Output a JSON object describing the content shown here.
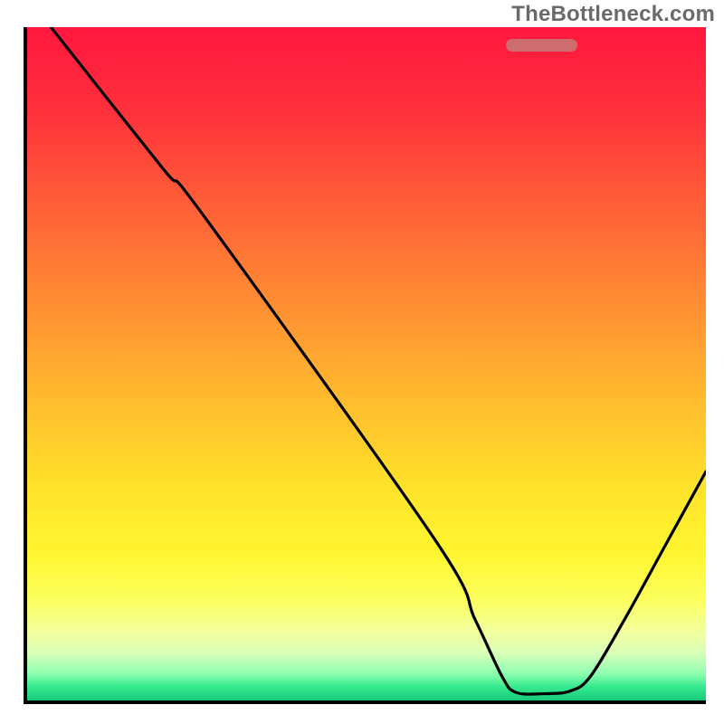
{
  "watermark": "TheBottleneck.com",
  "gradient_stops": [
    {
      "pct": 0,
      "color": "#ff173e"
    },
    {
      "pct": 12,
      "color": "#ff2f3c"
    },
    {
      "pct": 25,
      "color": "#ff5a38"
    },
    {
      "pct": 40,
      "color": "#ff8a33"
    },
    {
      "pct": 55,
      "color": "#ffba2e"
    },
    {
      "pct": 68,
      "color": "#ffe12a"
    },
    {
      "pct": 78,
      "color": "#fff62f"
    },
    {
      "pct": 85,
      "color": "#fcff5d"
    },
    {
      "pct": 90,
      "color": "#f2ffa0"
    },
    {
      "pct": 93,
      "color": "#d8ffb8"
    },
    {
      "pct": 96,
      "color": "#8dffb0"
    },
    {
      "pct": 98,
      "color": "#35e98e"
    },
    {
      "pct": 100,
      "color": "#16c97a"
    }
  ],
  "marker": {
    "x_pct_start": 70.5,
    "x_pct_end": 81.0,
    "y_pct": 97.3,
    "height_pct": 1.8,
    "color": "#cd6d6f"
  },
  "chart_data": {
    "type": "line",
    "title": "",
    "xlabel": "",
    "ylabel": "",
    "xlim": [
      0,
      100
    ],
    "ylim": [
      0,
      100
    ],
    "grid": false,
    "curve_points": [
      {
        "x": 3.5,
        "y": 100
      },
      {
        "x": 20,
        "y": 79
      },
      {
        "x": 26,
        "y": 72
      },
      {
        "x": 60,
        "y": 24
      },
      {
        "x": 66,
        "y": 12
      },
      {
        "x": 70,
        "y": 3.5
      },
      {
        "x": 72,
        "y": 1.2
      },
      {
        "x": 76,
        "y": 1.0
      },
      {
        "x": 80,
        "y": 1.4
      },
      {
        "x": 83,
        "y": 3.6
      },
      {
        "x": 88,
        "y": 12
      },
      {
        "x": 94,
        "y": 23
      },
      {
        "x": 100,
        "y": 34
      }
    ],
    "highlight_band": {
      "x_start": 70.5,
      "x_end": 81.0,
      "y": 2.7
    }
  }
}
